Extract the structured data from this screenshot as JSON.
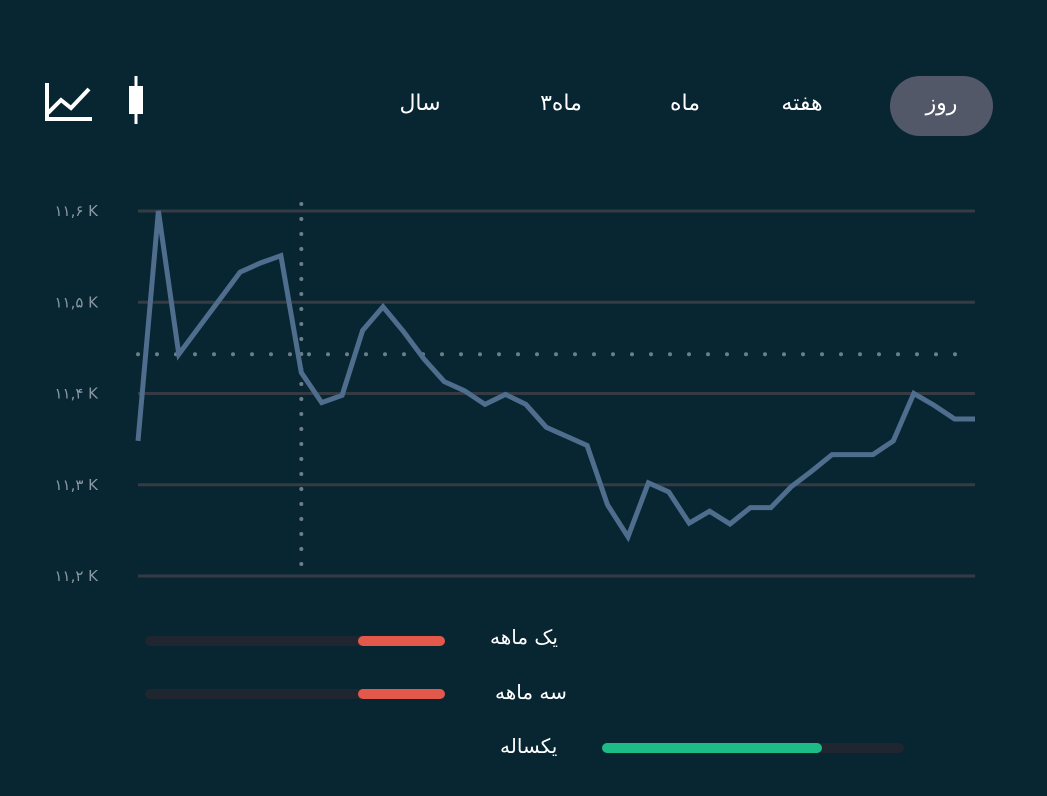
{
  "header": {
    "icons": {
      "line_chart": "line-chart-icon",
      "candlestick": "candlestick-icon"
    },
    "tabs": [
      {
        "label": "سال",
        "active": false
      },
      {
        "label": "۳ماه",
        "active": false
      },
      {
        "label": "ماه",
        "active": false
      },
      {
        "label": "هفته",
        "active": false
      },
      {
        "label": "روز",
        "active": true
      }
    ]
  },
  "chart_data": {
    "type": "line",
    "title": "",
    "xlabel": "",
    "ylabel": "",
    "y_tick_labels": [
      "۱۱,۶ K",
      "۱۱,۵ K",
      "۱۱,۴ K",
      "۱۱,۳ K",
      "۱۱,۲ K"
    ],
    "y_ticks": [
      11.6,
      11.5,
      11.4,
      11.3,
      11.2
    ],
    "ylim": [
      11.2,
      11.6
    ],
    "grid": true,
    "crosshair": {
      "x_index": 8,
      "y": 11.443
    },
    "series": [
      {
        "color": "#4f6d8c",
        "values": [
          11.348,
          11.6,
          11.443,
          11.473,
          11.503,
          11.533,
          11.543,
          11.551,
          11.423,
          11.39,
          11.398,
          11.469,
          11.495,
          11.468,
          11.438,
          11.413,
          11.403,
          11.388,
          11.399,
          11.388,
          11.363,
          11.353,
          11.343,
          11.278,
          11.243,
          11.302,
          11.292,
          11.258,
          11.271,
          11.257,
          11.275,
          11.275,
          11.298,
          11.315,
          11.333,
          11.333,
          11.333,
          11.348,
          11.4,
          11.387,
          11.372,
          11.372
        ]
      }
    ]
  },
  "performance": [
    {
      "label": "یک ماهه",
      "value_fraction": 0.29,
      "color": "#e2584a"
    },
    {
      "label": "سه ماهه",
      "value_fraction": 0.29,
      "color": "#e2584a"
    },
    {
      "label": "یکساله",
      "value_fraction": 0.73,
      "color": "#1dbb86"
    }
  ],
  "colors": {
    "background": "#082532",
    "gridline": "#363b43",
    "crosshair": "#6b7f8a",
    "axis_label": "#8a98a2",
    "tab_active_bg": "#525868",
    "bar_track": "#202630"
  }
}
